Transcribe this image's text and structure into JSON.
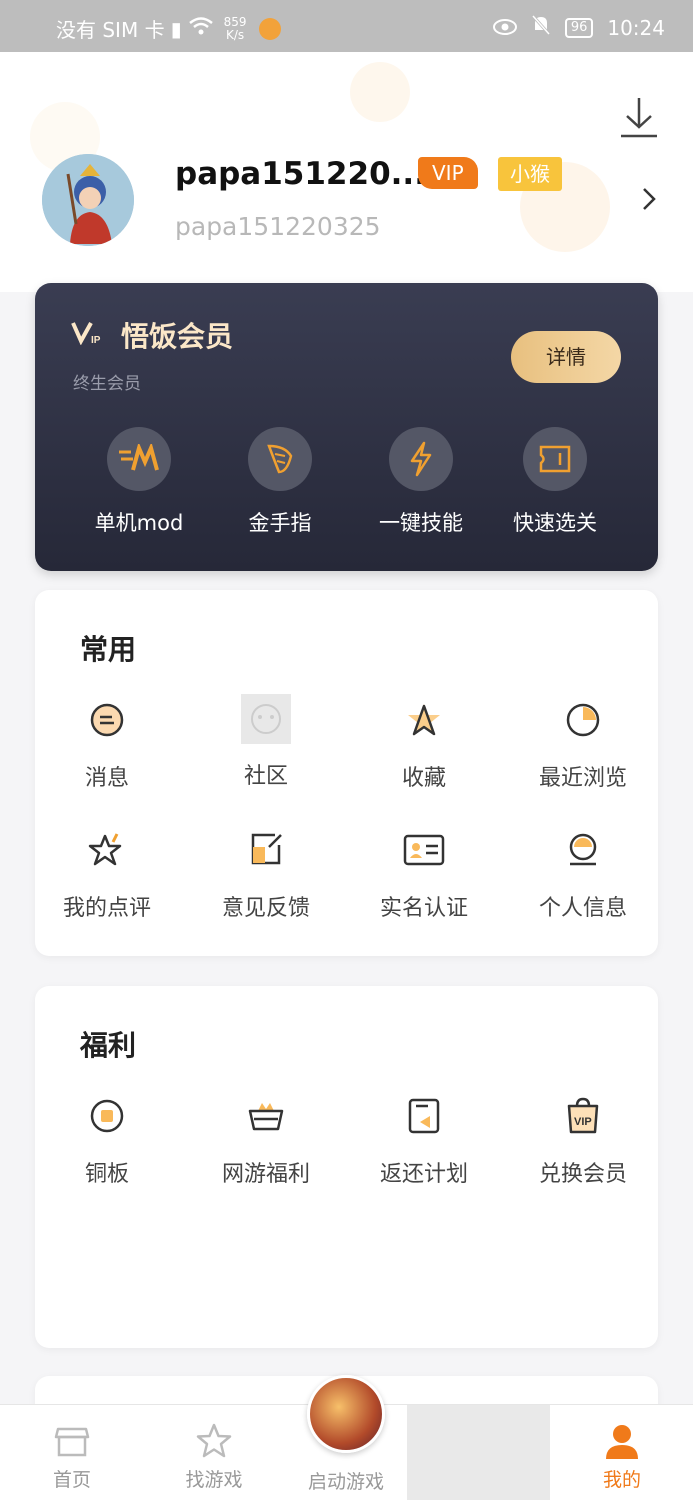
{
  "status_bar": {
    "carrier": "没有 SIM 卡",
    "net_speed_value": "859",
    "net_speed_unit": "K/s",
    "battery": "96",
    "time": "10:24"
  },
  "profile": {
    "username": "papa151220...",
    "user_id": "papa151220325",
    "vip_badge": "VIP",
    "level_badge": "小猴"
  },
  "vip_card": {
    "logo_text": "VIP",
    "title": "悟饭会员",
    "subtitle": "终生会员",
    "detail_button": "详情",
    "features": [
      {
        "label": "单机mod",
        "icon": "mod-m-icon"
      },
      {
        "label": "金手指",
        "icon": "wing-icon"
      },
      {
        "label": "一键技能",
        "icon": "lightning-icon"
      },
      {
        "label": "快速选关",
        "icon": "ticket-icon"
      }
    ]
  },
  "common": {
    "title": "常用",
    "items": [
      {
        "label": "消息",
        "icon": "message-icon"
      },
      {
        "label": "社区",
        "icon": "community-icon"
      },
      {
        "label": "收藏",
        "icon": "star-icon"
      },
      {
        "label": "最近浏览",
        "icon": "clock-pie-icon"
      },
      {
        "label": "我的点评",
        "icon": "review-star-icon"
      },
      {
        "label": "意见反馈",
        "icon": "feedback-edit-icon"
      },
      {
        "label": "实名认证",
        "icon": "id-card-icon"
      },
      {
        "label": "个人信息",
        "icon": "user-info-icon"
      }
    ]
  },
  "welfare": {
    "title": "福利",
    "items": [
      {
        "label": "铜板",
        "icon": "coin-icon"
      },
      {
        "label": "网游福利",
        "icon": "crown-basket-icon"
      },
      {
        "label": "返还计划",
        "icon": "return-icon"
      },
      {
        "label": "兑换会员",
        "icon": "vip-bag-icon"
      }
    ]
  },
  "bottom_nav": {
    "items": [
      {
        "label": "首页",
        "icon": "home-store-icon"
      },
      {
        "label": "找游戏",
        "icon": "star-outline-icon"
      },
      {
        "label": "启动游戏",
        "icon": "game-launch-icon"
      },
      {
        "label": "我的",
        "icon": "person-icon"
      }
    ]
  },
  "colors": {
    "accent": "#f07a1a",
    "vip_gold": "#e8c07f",
    "vip_card_bg": "#2e3143",
    "icon_dark": "#333333"
  }
}
